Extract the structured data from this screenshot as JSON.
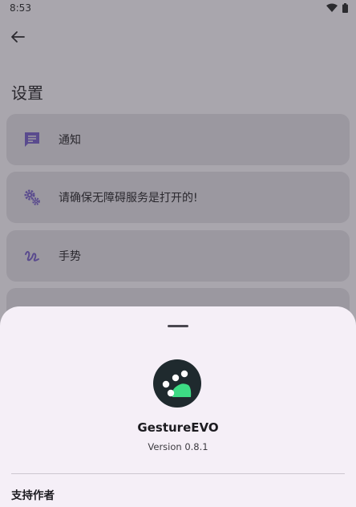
{
  "status_bar": {
    "time": "8:53",
    "icons": [
      "wifi-icon",
      "battery-icon"
    ]
  },
  "app_bar": {
    "back_icon": "arrow-left-icon"
  },
  "page": {
    "title": "设置"
  },
  "settings": [
    {
      "icon": "message-icon",
      "label": "通知"
    },
    {
      "icon": "gears-icon",
      "label": "请确保无障碍服务是打开的!"
    },
    {
      "icon": "gesture-icon",
      "label": "手势"
    }
  ],
  "about_sheet": {
    "app_name": "GestureEVO",
    "version": "Version 0.8.1",
    "support_label": "支持作者"
  },
  "colors": {
    "accent": "#5a4b8e",
    "logo_bg": "#1f2a2e",
    "logo_accent": "#3ddc84",
    "sheet_bg": "#f5eff7",
    "scrim_bg": "#a9a6ad"
  }
}
